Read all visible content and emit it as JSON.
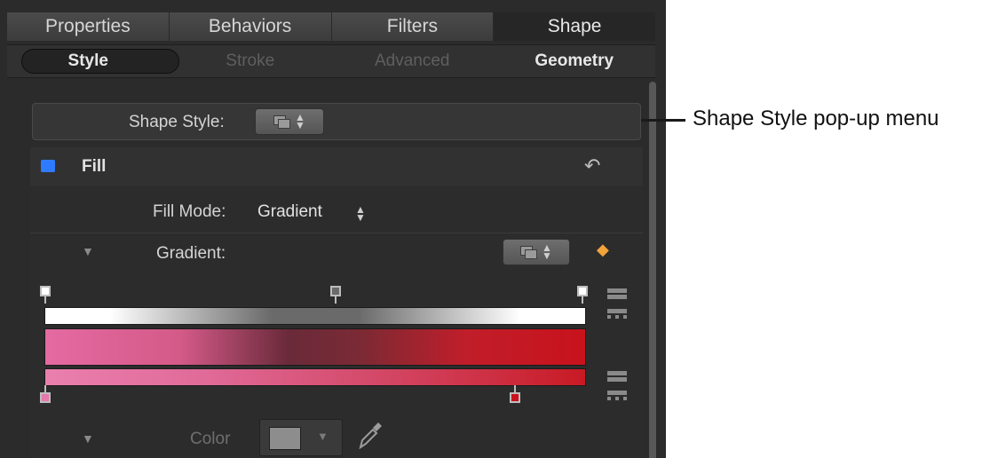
{
  "tabs": [
    {
      "label": "Properties"
    },
    {
      "label": "Behaviors"
    },
    {
      "label": "Filters"
    },
    {
      "label": "Shape"
    }
  ],
  "subtabs": [
    {
      "label": "Style"
    },
    {
      "label": "Stroke"
    },
    {
      "label": "Advanced"
    },
    {
      "label": "Geometry"
    }
  ],
  "shape_style": {
    "label": "Shape Style:"
  },
  "fill": {
    "title": "Fill",
    "enabled": true,
    "mode_label": "Fill Mode:",
    "mode_value": "Gradient",
    "gradient_label": "Gradient:",
    "color_label": "Color"
  },
  "gradient": {
    "stops_top": [
      "#ffffff",
      "#6a6a6a",
      "#ffffff"
    ],
    "stops_bottom": [
      "#e778ab",
      "#c8121c"
    ]
  },
  "callout": {
    "text": "Shape Style pop-up menu"
  },
  "colors": {
    "accent": "#2f7bff",
    "keyframe": "#f2a33a",
    "panel_bg": "#2b2b2b"
  }
}
